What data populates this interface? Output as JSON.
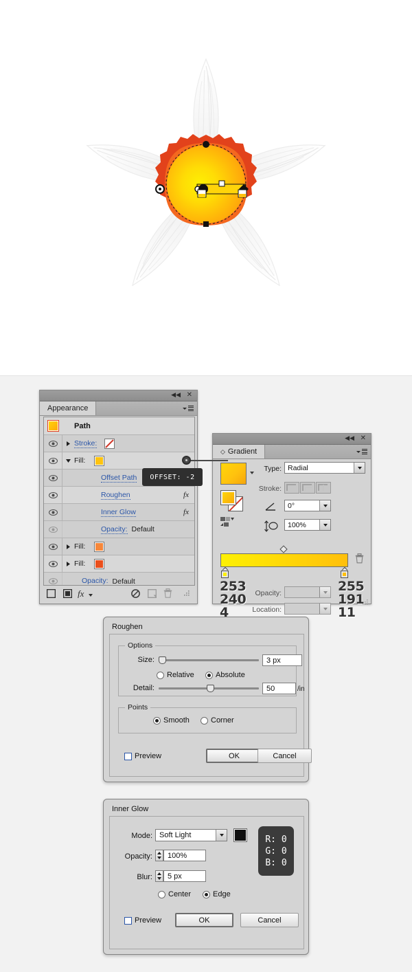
{
  "canvas": {
    "name": "illustrator-artboard",
    "description": "white artboard with a five-petal white daffodil flower and a selected orange-yellow radial-gradient center being edited with the gradient tool"
  },
  "appearance_panel": {
    "tab_label": "Appearance",
    "title_collapse_icon": "collapse-icon",
    "title_close_icon": "close-icon",
    "menu_icon": "panel-menu-icon",
    "rows": [
      {
        "kind": "header",
        "label": "Path",
        "swatch": "#ffc20e",
        "has_eye": false,
        "has_disclosure": false
      },
      {
        "kind": "item",
        "label": "Stroke:",
        "link": true,
        "swatch": "none",
        "has_eye": true,
        "disclosure": "right"
      },
      {
        "kind": "item",
        "label": "Fill:",
        "link": false,
        "swatch": "#ffc30f",
        "has_eye": true,
        "disclosure": "down"
      },
      {
        "kind": "sub",
        "label": "Offset Path",
        "link": true,
        "has_eye": true,
        "fx": ""
      },
      {
        "kind": "sub",
        "label": "Roughen",
        "link": true,
        "has_eye": true,
        "fx": "fx"
      },
      {
        "kind": "sub",
        "label": "Inner Glow",
        "link": true,
        "has_eye": true,
        "fx": "fx"
      },
      {
        "kind": "sub",
        "label": "Opacity:",
        "value": "Default",
        "link": true,
        "has_eye": true,
        "eye_dim": true
      },
      {
        "kind": "item",
        "label": "Fill:",
        "link": false,
        "swatch": "#f6873a",
        "has_eye": true,
        "disclosure": "right"
      },
      {
        "kind": "item",
        "label": "Fill:",
        "link": false,
        "swatch": "#ea4f1c",
        "has_eye": true,
        "disclosure": "right"
      },
      {
        "kind": "sub",
        "label": "Opacity:",
        "value": "Default",
        "link": true,
        "has_eye": true,
        "eye_dim": true
      }
    ],
    "footer_icons": [
      "add-new-stroke-icon",
      "add-new-fill-icon",
      "add-new-effect-icon",
      "clear-appearance-icon",
      "duplicate-item-icon",
      "delete-item-icon",
      "resize-grip-icon"
    ]
  },
  "tooltip": {
    "text": "OFFSET: -2",
    "knob_name": "offset-drag-knob"
  },
  "gradient_panel": {
    "tab_label": "Gradient",
    "title_collapse_icon": "collapse-icon",
    "title_close_icon": "close-icon",
    "menu_icon": "panel-menu-icon",
    "type_label": "Type:",
    "type_value": "Radial",
    "stroke_label": "Stroke:",
    "stroke_options": [
      "stroke-gradient-within-icon",
      "stroke-gradient-along-icon",
      "stroke-gradient-across-icon"
    ],
    "angle_label_icon": "angle-icon",
    "angle_value": "0°",
    "aspect_label_icon": "aspect-ratio-icon",
    "aspect_value": "100%",
    "opacity_label": "Opacity:",
    "opacity_value": "",
    "location_label": "Location:",
    "location_value": "",
    "delete_stop_icon": "trash-icon",
    "reverse_gradient_icon": "reverse-gradient-icon",
    "gradient_left_color": "#fdf004",
    "gradient_right_color": "#ffbf0b",
    "stops": [
      {
        "position": "left",
        "r": "253",
        "g": "240",
        "b": "4",
        "color": "#fdf004"
      },
      {
        "position": "right",
        "r": "255",
        "g": "191",
        "b": "11",
        "color": "#ffbf0b"
      }
    ]
  },
  "roughen_dialog": {
    "title": "Roughen",
    "options_legend": "Options",
    "size_label": "Size:",
    "size_value": "3 px",
    "size_slider_pct": 4,
    "relative_label": "Relative",
    "absolute_label": "Absolute",
    "size_mode": "Absolute",
    "detail_label": "Detail:",
    "detail_value": "50",
    "detail_unit": "/in",
    "detail_slider_pct": 48,
    "points_legend": "Points",
    "smooth_label": "Smooth",
    "corner_label": "Corner",
    "points_mode": "Smooth",
    "preview_label": "Preview",
    "preview_checked": false,
    "ok_label": "OK",
    "cancel_label": "Cancel"
  },
  "innerglow_dialog": {
    "title": "Inner Glow",
    "mode_label": "Mode:",
    "mode_value": "Soft Light",
    "color_swatch": "#101010",
    "rgb_readout": {
      "r": "R: 0",
      "g": "G: 0",
      "b": "B: 0"
    },
    "opacity_label": "Opacity:",
    "opacity_value": "100%",
    "blur_label": "Blur:",
    "blur_value": "5 px",
    "center_label": "Center",
    "edge_label": "Edge",
    "origin_mode": "Edge",
    "preview_label": "Preview",
    "preview_checked": false,
    "ok_label": "OK",
    "cancel_label": "Cancel"
  }
}
